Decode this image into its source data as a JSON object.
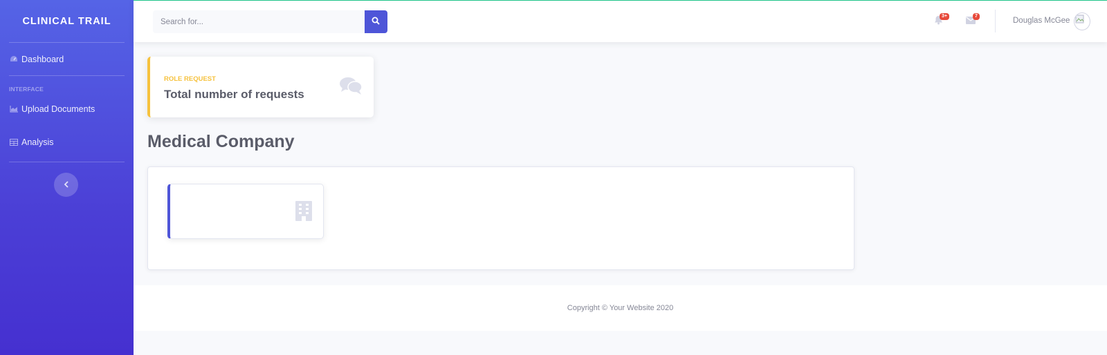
{
  "sidebar": {
    "brand": "CLINICAL TRAIL",
    "items": [
      {
        "label": "Dashboard",
        "icon": "tachometer-icon"
      },
      {
        "label": "Upload Documents",
        "icon": "chart-area-icon"
      },
      {
        "label": "Analysis",
        "icon": "table-icon"
      }
    ],
    "heading": "INTERFACE",
    "toggle_icon": "chevron-left-icon"
  },
  "topbar": {
    "search_placeholder": "Search for...",
    "alerts_badge": "3+",
    "messages_badge": "7",
    "user_name": "Douglas McGee"
  },
  "request_card": {
    "label": "ROLE REQUEST",
    "title": "Total number of requests",
    "icon": "comments-icon"
  },
  "section": {
    "title": "Medical Company",
    "card_icon": "building-icon"
  },
  "footer": {
    "copyright": "Copyright © Your Website 2020"
  },
  "colors": {
    "sidebar_top": "#5564e6",
    "sidebar_bottom": "#4530d0",
    "primary": "#4e55d8",
    "warning": "#f6c23e",
    "danger": "#e74a3b",
    "text": "#5a5c69",
    "muted": "#858796"
  }
}
